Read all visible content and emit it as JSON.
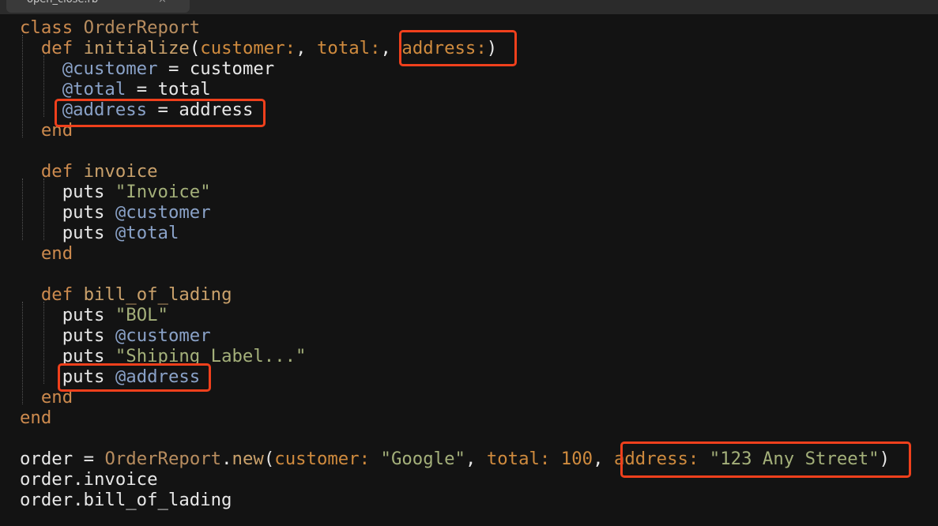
{
  "tab": {
    "filename": "open_close.rb",
    "close_glyph": "×"
  },
  "code": {
    "l1": {
      "kw": "class",
      "name": "OrderReport"
    },
    "l2": {
      "kw": "def",
      "method": "initialize",
      "open": "(",
      "p1": "customer:",
      "sep1": ",",
      "p2": "total:",
      "sep2": ",",
      "p3": "address:",
      "close": ")"
    },
    "l3": {
      "ivar": "@customer",
      "op": "=",
      "val": "customer"
    },
    "l4": {
      "ivar": "@total",
      "op": "=",
      "val": "total"
    },
    "l5": {
      "ivar": "@address",
      "op": "=",
      "val": "address"
    },
    "l6": {
      "kw": "end"
    },
    "l8": {
      "kw": "def",
      "method": "invoice"
    },
    "l9": {
      "call": "puts",
      "arg": "\"Invoice\""
    },
    "l10": {
      "call": "puts",
      "arg": "@customer"
    },
    "l11": {
      "call": "puts",
      "arg": "@total"
    },
    "l12": {
      "kw": "end"
    },
    "l14": {
      "kw": "def",
      "method": "bill_of_lading"
    },
    "l15": {
      "call": "puts",
      "arg": "\"BOL\""
    },
    "l16": {
      "call": "puts",
      "arg": "@customer"
    },
    "l17": {
      "call": "puts",
      "arg": "\"Shiping Label...\""
    },
    "l18": {
      "call": "puts",
      "arg": "@address"
    },
    "l19": {
      "kw": "end"
    },
    "l20": {
      "kw": "end"
    },
    "l22": {
      "var": "order",
      "op": "=",
      "cls": "OrderReport",
      "dot": ".",
      "method": "new",
      "open": "(",
      "k1": "customer:",
      "v1": "\"Google\"",
      "sep1": ",",
      "k2": "total:",
      "v2": "100",
      "sep2": ",",
      "k3": "address:",
      "v3": "\"123 Any Street\"",
      "close": ")"
    },
    "l23": {
      "text": "order.invoice"
    },
    "l24": {
      "text": "order.bill_of_lading"
    }
  },
  "colors": {
    "highlight_box": "#f0401c",
    "background": "#131313"
  }
}
